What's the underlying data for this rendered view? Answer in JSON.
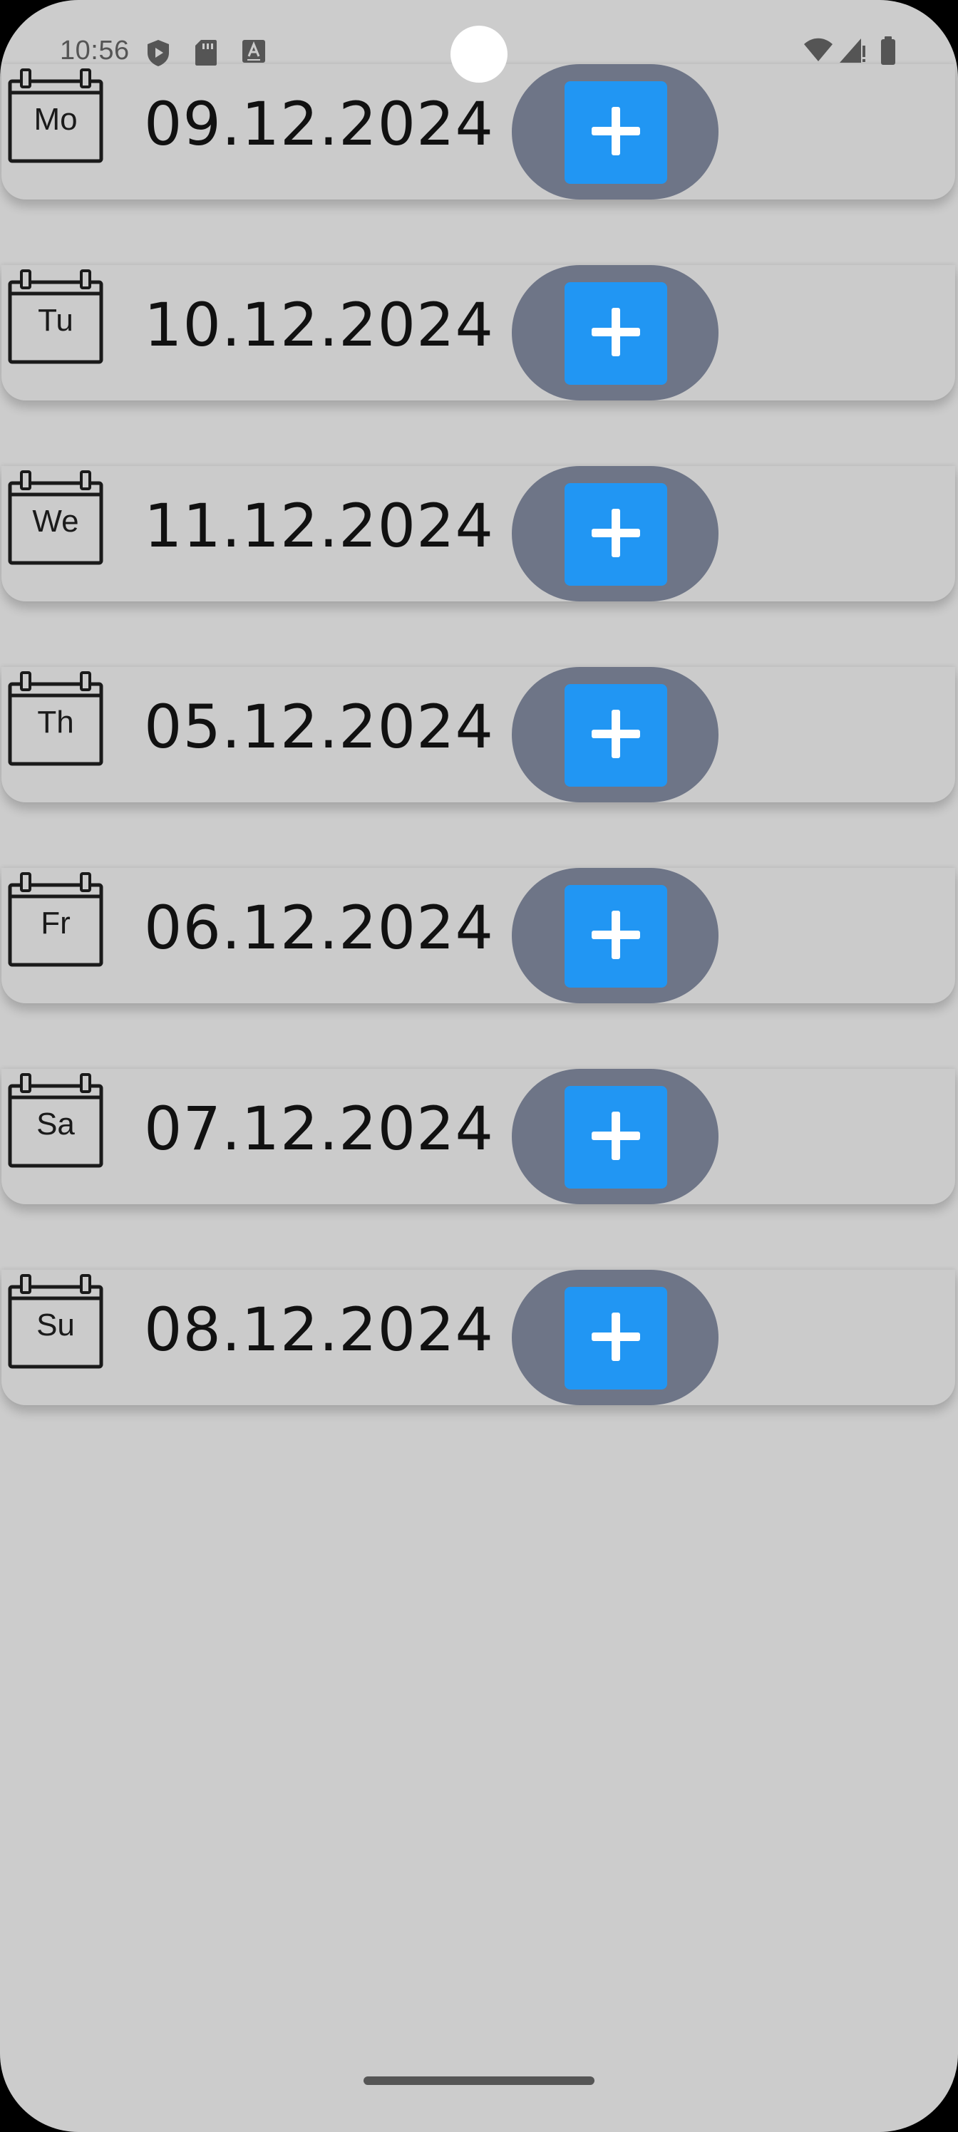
{
  "status_bar": {
    "time": "10:56",
    "left_icons": [
      "shield-play-icon",
      "sd-card-icon",
      "keyboard-a-icon"
    ],
    "right_icons": [
      "wifi-icon",
      "cellular-signal-icon",
      "battery-icon"
    ]
  },
  "days": [
    {
      "label": "Mo",
      "date": "09.12.2024",
      "icon": "calendar-icon",
      "action_icon": "plus-icon"
    },
    {
      "label": "Tu",
      "date": "10.12.2024",
      "icon": "calendar-icon",
      "action_icon": "plus-icon"
    },
    {
      "label": "We",
      "date": "11.12.2024",
      "icon": "calendar-icon",
      "action_icon": "plus-icon"
    },
    {
      "label": "Th",
      "date": "05.12.2024",
      "icon": "calendar-icon",
      "action_icon": "plus-icon"
    },
    {
      "label": "Fr",
      "date": "06.12.2024",
      "icon": "calendar-icon",
      "action_icon": "plus-icon"
    },
    {
      "label": "Sa",
      "date": "07.12.2024",
      "icon": "calendar-icon",
      "action_icon": "plus-icon"
    },
    {
      "label": "Su",
      "date": "08.12.2024",
      "icon": "calendar-icon",
      "action_icon": "plus-icon"
    }
  ],
  "colors": {
    "background": "#cccccc",
    "row_background": "#cbcbcb",
    "pill": "#6e7587",
    "add_button": "#2196f3",
    "text": "#111111"
  }
}
